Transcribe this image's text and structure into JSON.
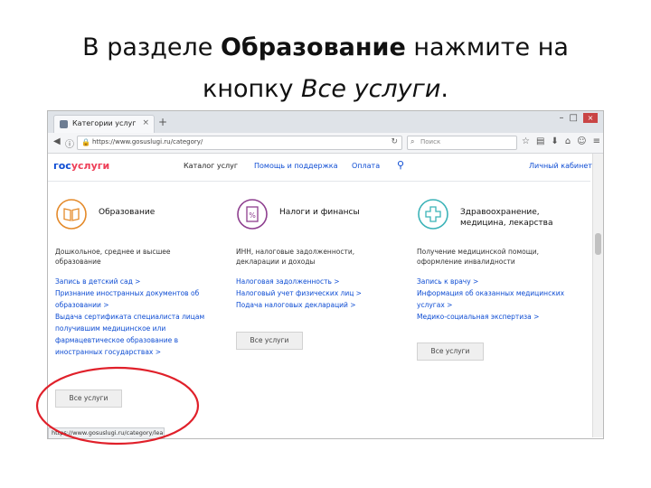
{
  "slide": {
    "title_part1": "В разделе ",
    "title_bold": "Образование",
    "title_part2": " нажмите на",
    "title_line2_a": "кнопку ",
    "title_italic": "Все услуги",
    "title_end": "."
  },
  "browser": {
    "tab_title": "Категории услуг",
    "tab_close": "×",
    "new_tab": "+",
    "window_controls": [
      "–",
      "□"
    ],
    "window_close": "×",
    "url": "https://www.gosuslugi.ru/category/",
    "search_placeholder": "Поиск",
    "status_url": "https://www.gosuslugi.ru/category/learning"
  },
  "site": {
    "logo_gos": "гос",
    "logo_uslugi": "услуги",
    "nav": [
      "Каталог услуг",
      "Помощь и поддержка",
      "Оплата"
    ],
    "login": "Личный кабинет"
  },
  "categories": [
    {
      "icon": "book-icon",
      "title": "Образование",
      "description": "Дошкольное, среднее и высшее образование",
      "links": [
        "Запись в детский сад >",
        "Признание иностранных документов об",
        "образовании >",
        "Выдача сертификата специалиста лицам",
        "получившим медицинское или",
        "фармацевтическое образование в",
        "иностранных государствах >"
      ],
      "button": "Все услуги"
    },
    {
      "icon": "tax-document-icon",
      "title": "Налоги и финансы",
      "description": "ИНН, налоговые задолженности, декларации и доходы",
      "links": [
        "Налоговая задолженность >",
        "Налоговый учет физических лиц >",
        "Подача налоговых деклараций >"
      ],
      "button": "Все услуги"
    },
    {
      "icon": "medical-cross-icon",
      "title_line1": "Здравоохранение,",
      "title_line2": "медицина, лекарства",
      "description": "Получение медицинской помощи, оформление инвалидности",
      "links": [
        "Запись к врачу >",
        "Информация об оказанных медицинских",
        "услугах >",
        "Медико-социальная экспертиза >"
      ],
      "button": "Все услуги"
    }
  ],
  "colors": {
    "education": "#e48a2a",
    "finance": "#8e3f8f",
    "health": "#3bb3b8",
    "link": "#0d4cd3",
    "highlight": "#e0202a"
  }
}
